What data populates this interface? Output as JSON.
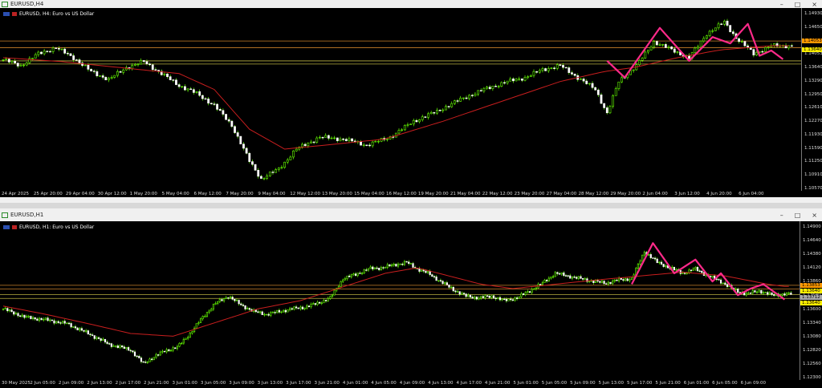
{
  "windows": [
    {
      "title": "EURUSD,H4",
      "symbol_label": "EURUSD, H4:  Euro vs US Dollar",
      "controls": [
        "–",
        "□",
        "×"
      ],
      "chart_data": {
        "type": "candlestick",
        "timeframe": "H4",
        "y_ticks": [
          "1.14930",
          "1.14650",
          "1.14370",
          "1.14053",
          "1.13640",
          "1.13290",
          "1.12950",
          "1.12610",
          "1.12270",
          "1.11930",
          "1.11590",
          "1.11250",
          "1.10910",
          "1.10570"
        ],
        "x_ticks": [
          "24 Apr 2025",
          "25 Apr 20:00",
          "29 Apr 04:00",
          "30 Apr 12:00",
          "1 May 20:00",
          "5 May 04:00",
          "6 May 12:00",
          "7 May 20:00",
          "9 May 04:00",
          "12 May 12:00",
          "13 May 20:00",
          "15 May 04:00",
          "16 May 12:00",
          "19 May 20:00",
          "21 May 04:00",
          "22 May 12:00",
          "23 May 20:00",
          "27 May 04:00",
          "28 May 12:00",
          "29 May 20:00",
          "2 Jun 04:00",
          "3 Jun 12:00",
          "4 Jun 20:00",
          "6 Jun 04:00"
        ],
        "price_tags": [
          {
            "label": "1.14053",
            "color": "#ff9900"
          },
          {
            "label": "1.13640",
            "color": "#ffee00"
          }
        ],
        "ylim": [
          1.1045,
          1.1505
        ],
        "horizontal_levels": [
          {
            "value": 1.1422,
            "color": "#c87f2a"
          },
          {
            "value": 1.1405,
            "color": "#c87f2a"
          },
          {
            "value": 1.1372,
            "color": "#b8b040"
          },
          {
            "value": 1.1364,
            "color": "#b8b040"
          }
        ],
        "close_path": [
          [
            0,
            1.1375
          ],
          [
            6,
            1.136
          ],
          [
            12,
            1.139
          ],
          [
            18,
            1.1405
          ],
          [
            24,
            1.138
          ],
          [
            30,
            1.1345
          ],
          [
            36,
            1.1325
          ],
          [
            42,
            1.1355
          ],
          [
            48,
            1.137
          ],
          [
            54,
            1.134
          ],
          [
            60,
            1.131
          ],
          [
            66,
            1.129
          ],
          [
            72,
            1.126
          ],
          [
            78,
            1.121
          ],
          [
            84,
            1.112
          ],
          [
            88,
            1.1075
          ],
          [
            94,
            1.11
          ],
          [
            100,
            1.115
          ],
          [
            108,
            1.118
          ],
          [
            116,
            1.1175
          ],
          [
            124,
            1.116
          ],
          [
            132,
            1.118
          ],
          [
            140,
            1.122
          ],
          [
            148,
            1.1245
          ],
          [
            156,
            1.1275
          ],
          [
            164,
            1.13
          ],
          [
            172,
            1.132
          ],
          [
            178,
            1.133
          ],
          [
            184,
            1.135
          ],
          [
            190,
            1.136
          ],
          [
            196,
            1.133
          ],
          [
            202,
            1.13
          ],
          [
            206,
            1.124
          ],
          [
            210,
            1.132
          ],
          [
            216,
            1.136
          ],
          [
            222,
            1.142
          ],
          [
            228,
            1.14
          ],
          [
            234,
            1.138
          ],
          [
            240,
            1.144
          ],
          [
            246,
            1.147
          ],
          [
            250,
            1.143
          ],
          [
            256,
            1.139
          ],
          [
            262,
            1.141
          ]
        ],
        "ma": [
          [
            0,
            1.138
          ],
          [
            20,
            1.137
          ],
          [
            40,
            1.1355
          ],
          [
            60,
            1.134
          ],
          [
            72,
            1.13
          ],
          [
            84,
            1.12
          ],
          [
            96,
            1.115
          ],
          [
            110,
            1.116
          ],
          [
            130,
            1.1175
          ],
          [
            150,
            1.122
          ],
          [
            170,
            1.127
          ],
          [
            190,
            1.132
          ],
          [
            205,
            1.1345
          ],
          [
            215,
            1.1355
          ],
          [
            230,
            1.138
          ],
          [
            245,
            1.14
          ],
          [
            262,
            1.141
          ]
        ],
        "zigzag": [
          [
            206,
            1.1372
          ],
          [
            212,
            1.133
          ],
          [
            224,
            1.1455
          ],
          [
            234,
            1.1372
          ],
          [
            242,
            1.1432
          ],
          [
            248,
            1.1416
          ],
          [
            254,
            1.1465
          ],
          [
            258,
            1.1385
          ],
          [
            262,
            1.1398
          ],
          [
            266,
            1.1376
          ]
        ],
        "x_count": 270
      }
    },
    {
      "title": "EURUSD,H1",
      "symbol_label": "EURUSD, H1:  Euro vs US Dollar",
      "controls": [
        "–",
        "□",
        "×"
      ],
      "chart_data": {
        "type": "candlestick",
        "timeframe": "H1",
        "y_ticks": [
          "1.14900",
          "1.14640",
          "1.14380",
          "1.14120",
          "1.13860",
          "1.13640",
          "1.13600",
          "1.13340",
          "1.13080",
          "1.12820",
          "1.12560",
          "1.12300"
        ],
        "x_ticks": [
          "30 May 2025",
          "2 Jun 05:00",
          "2 Jun 09:00",
          "2 Jun 13:00",
          "2 Jun 17:00",
          "2 Jun 21:00",
          "3 Jun 01:00",
          "3 Jun 05:00",
          "3 Jun 09:00",
          "3 Jun 13:00",
          "3 Jun 17:00",
          "3 Jun 21:00",
          "4 Jun 01:00",
          "4 Jun 05:00",
          "4 Jun 09:00",
          "4 Jun 13:00",
          "4 Jun 17:00",
          "4 Jun 21:00",
          "5 Jun 01:00",
          "5 Jun 05:00",
          "5 Jun 09:00",
          "5 Jun 13:00",
          "5 Jun 17:00",
          "5 Jun 21:00",
          "6 Jun 01:00",
          "6 Jun 05:00",
          "6 Jun 09:00"
        ],
        "price_tags": [
          {
            "label": "1.13853",
            "color": "#ff9900"
          },
          {
            "label": "1.13640",
            "color": "#ffee00"
          },
          {
            "label": "1.13712",
            "color": "#aaaaaa"
          },
          {
            "label": "1.13640",
            "color": "#ffee00"
          }
        ],
        "ylim": [
          1.1215,
          1.1505
        ],
        "horizontal_levels": [
          {
            "value": 1.1388,
            "color": "#c87f2a"
          },
          {
            "value": 1.1381,
            "color": "#c87f2a"
          },
          {
            "value": 1.1371,
            "color": "#b8b040"
          },
          {
            "value": 1.1364,
            "color": "#b8b040"
          }
        ],
        "close_path": [
          [
            0,
            1.1345
          ],
          [
            10,
            1.133
          ],
          [
            20,
            1.1325
          ],
          [
            30,
            1.1318
          ],
          [
            40,
            1.13
          ],
          [
            50,
            1.128
          ],
          [
            60,
            1.127
          ],
          [
            66,
            1.1245
          ],
          [
            70,
            1.1255
          ],
          [
            76,
            1.1268
          ],
          [
            82,
            1.1275
          ],
          [
            88,
            1.13
          ],
          [
            94,
            1.133
          ],
          [
            100,
            1.1355
          ],
          [
            106,
            1.1368
          ],
          [
            112,
            1.1352
          ],
          [
            118,
            1.134
          ],
          [
            124,
            1.1335
          ],
          [
            130,
            1.134
          ],
          [
            136,
            1.1345
          ],
          [
            142,
            1.1348
          ],
          [
            148,
            1.1355
          ],
          [
            154,
            1.1365
          ],
          [
            160,
            1.14
          ],
          [
            166,
            1.1408
          ],
          [
            172,
            1.1418
          ],
          [
            178,
            1.142
          ],
          [
            184,
            1.1425
          ],
          [
            190,
            1.143
          ],
          [
            194,
            1.142
          ],
          [
            200,
            1.141
          ],
          [
            206,
            1.1395
          ],
          [
            212,
            1.138
          ],
          [
            218,
            1.1368
          ],
          [
            224,
            1.1365
          ],
          [
            230,
            1.1368
          ],
          [
            236,
            1.136
          ],
          [
            242,
            1.1365
          ],
          [
            248,
            1.1378
          ],
          [
            254,
            1.1392
          ],
          [
            260,
            1.141
          ],
          [
            266,
            1.1405
          ],
          [
            272,
            1.14
          ],
          [
            278,
            1.1395
          ],
          [
            284,
            1.1392
          ],
          [
            290,
            1.1398
          ],
          [
            296,
            1.14
          ],
          [
            302,
            1.145
          ],
          [
            308,
            1.143
          ],
          [
            314,
            1.142
          ],
          [
            320,
            1.141
          ],
          [
            326,
            1.1418
          ],
          [
            332,
            1.1405
          ],
          [
            338,
            1.1395
          ],
          [
            344,
            1.138
          ],
          [
            350,
            1.1372
          ],
          [
            356,
            1.1378
          ],
          [
            362,
            1.137
          ],
          [
            368,
            1.1372
          ]
        ],
        "ma": [
          [
            0,
            1.135
          ],
          [
            20,
            1.1335
          ],
          [
            40,
            1.1318
          ],
          [
            60,
            1.13
          ],
          [
            80,
            1.1295
          ],
          [
            100,
            1.132
          ],
          [
            120,
            1.1345
          ],
          [
            140,
            1.136
          ],
          [
            160,
            1.1385
          ],
          [
            180,
            1.141
          ],
          [
            195,
            1.142
          ],
          [
            210,
            1.1405
          ],
          [
            225,
            1.139
          ],
          [
            240,
            1.1382
          ],
          [
            260,
            1.139
          ],
          [
            280,
            1.1398
          ],
          [
            300,
            1.1405
          ],
          [
            320,
            1.1412
          ],
          [
            340,
            1.1405
          ],
          [
            360,
            1.139
          ],
          [
            368,
            1.1386
          ]
        ],
        "zigzag": [
          [
            296,
            1.139
          ],
          [
            306,
            1.1465
          ],
          [
            316,
            1.141
          ],
          [
            326,
            1.1435
          ],
          [
            334,
            1.1395
          ],
          [
            338,
            1.141
          ],
          [
            346,
            1.137
          ],
          [
            352,
            1.1382
          ],
          [
            358,
            1.139
          ],
          [
            368,
            1.1362
          ]
        ],
        "x_count": 372
      }
    }
  ]
}
